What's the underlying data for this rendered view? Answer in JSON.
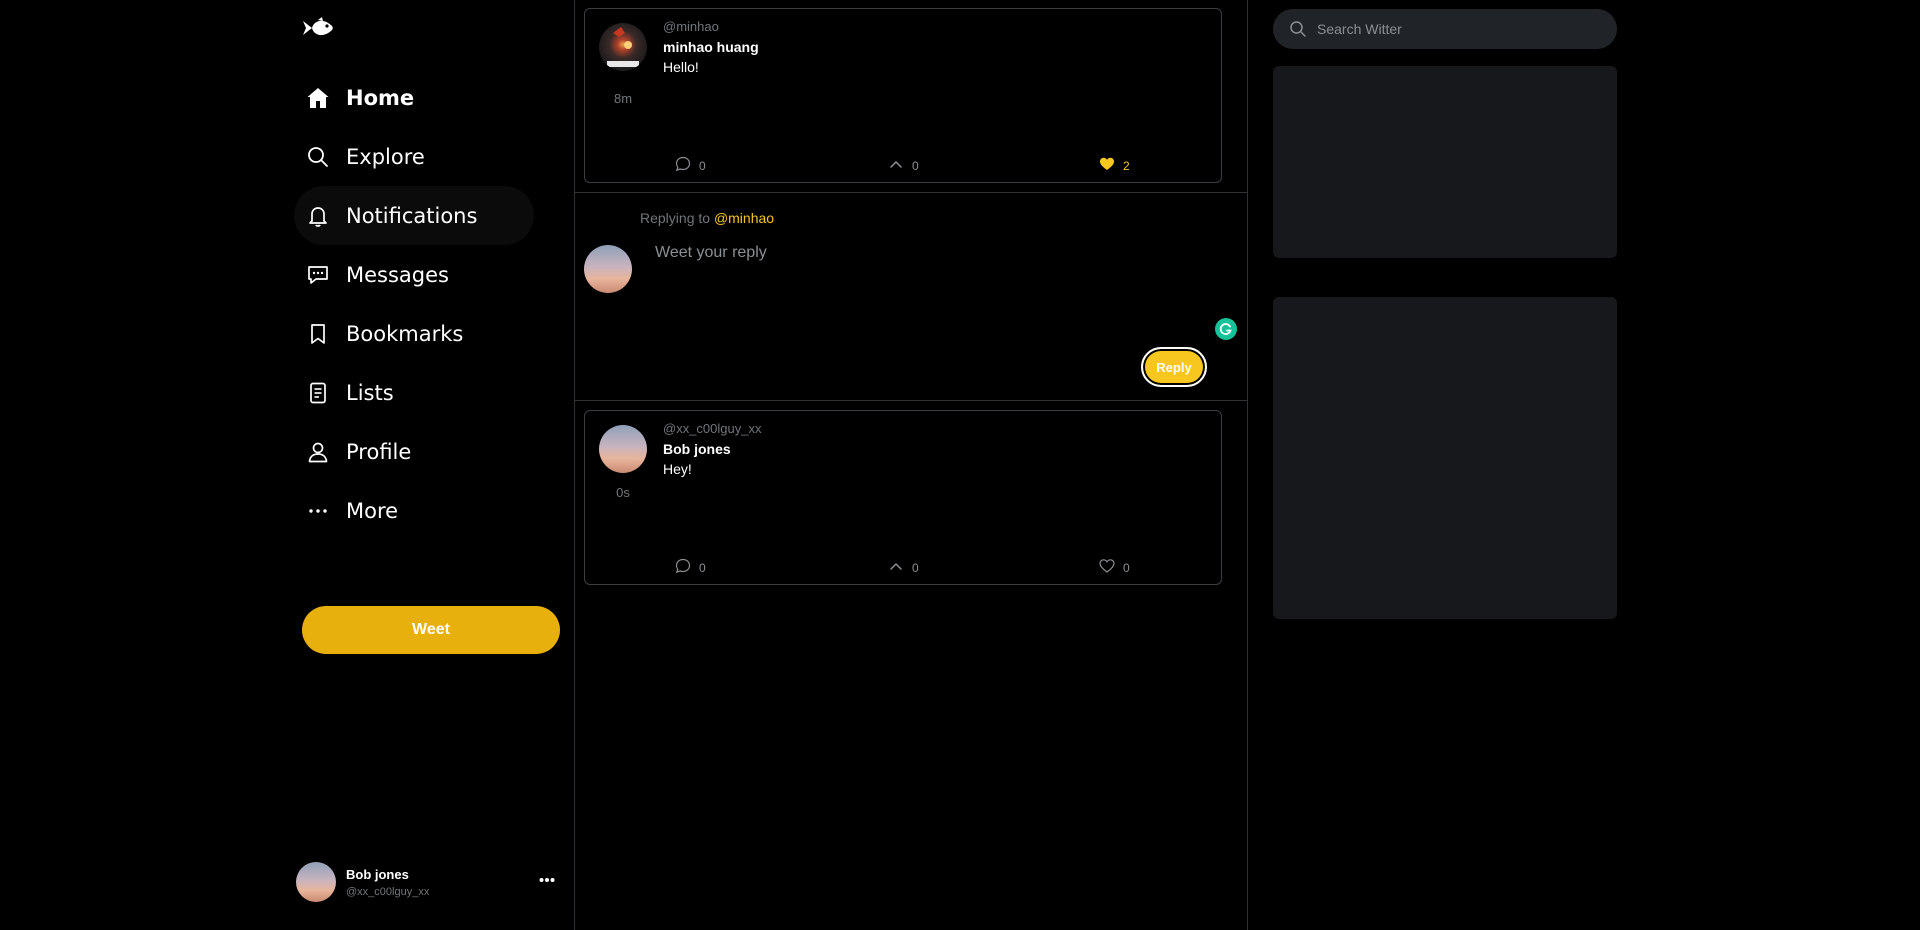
{
  "sidebar": {
    "logo": "fish-logo-icon",
    "items": [
      {
        "label": "Home",
        "icon": "home-icon"
      },
      {
        "label": "Explore",
        "icon": "search-icon"
      },
      {
        "label": "Notifications",
        "icon": "bell-icon"
      },
      {
        "label": "Messages",
        "icon": "message-icon"
      },
      {
        "label": "Bookmarks",
        "icon": "bookmark-icon"
      },
      {
        "label": "Lists",
        "icon": "list-icon"
      },
      {
        "label": "Profile",
        "icon": "person-icon"
      },
      {
        "label": "More",
        "icon": "more-dots-icon"
      }
    ],
    "weet_button": "Weet",
    "account": {
      "name": "Bob jones",
      "handle": "@xx_c00lguy_xx"
    }
  },
  "feed": {
    "original_weet": {
      "handle": "@minhao",
      "name": "minhao huang",
      "text": "Hello!",
      "time": "8m",
      "comments": "0",
      "reweets": "0",
      "likes": "2",
      "liked": true
    },
    "reply_box": {
      "replying_prefix": "Replying to",
      "replying_to": "@minhao",
      "placeholder": "Weet your reply",
      "button": "Reply"
    },
    "reply_weet": {
      "handle": "@xx_c00lguy_xx",
      "name": "Bob jones",
      "text": "Hey!",
      "time": "0s",
      "comments": "0",
      "reweets": "0",
      "likes": "0",
      "liked": false
    }
  },
  "right": {
    "search_placeholder": "Search Witter"
  },
  "colors": {
    "accent": "#e8b00d",
    "accent_light": "#f7c61f",
    "background": "#000000",
    "muted": "#71767b"
  }
}
